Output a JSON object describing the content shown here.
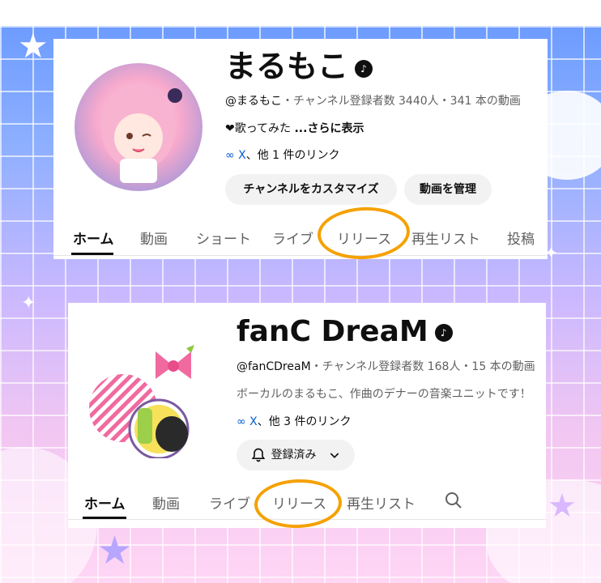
{
  "channel1": {
    "name": "まるもこ",
    "meta_handle": "@まるもこ",
    "meta_stats": "・チャンネル登録者数 3440人・341 本の動画",
    "description": "❤歌ってみた",
    "more_label": "...さらに表示",
    "link_label": "X",
    "link_more": "、他 1 件のリンク",
    "customize_button": "チャンネルをカスタマイズ",
    "manage_button": "動画を管理",
    "tabs": [
      "ホーム",
      "動画",
      "ショート",
      "ライブ",
      "リリース",
      "再生リスト",
      "投稿"
    ]
  },
  "channel2": {
    "name": "fanC DreaM",
    "meta_handle": "@fanCDreaM",
    "meta_stats": "・チャンネル登録者数 168人・15 本の動画",
    "description": "ボーカルのまるもこ、作曲のデナーの音楽ユニットです！",
    "link_label": "X",
    "link_more": "、他 3 件のリンク",
    "subscribed_button": "登録済み",
    "tabs": [
      "ホーム",
      "動画",
      "ライブ",
      "リリース",
      "再生リスト"
    ]
  },
  "colors": {
    "highlight": "#f5a100",
    "link": "#065fd4"
  },
  "icons": [
    "verified-music-icon",
    "link-icon",
    "bell-icon",
    "chevron-down-icon",
    "search-icon"
  ]
}
